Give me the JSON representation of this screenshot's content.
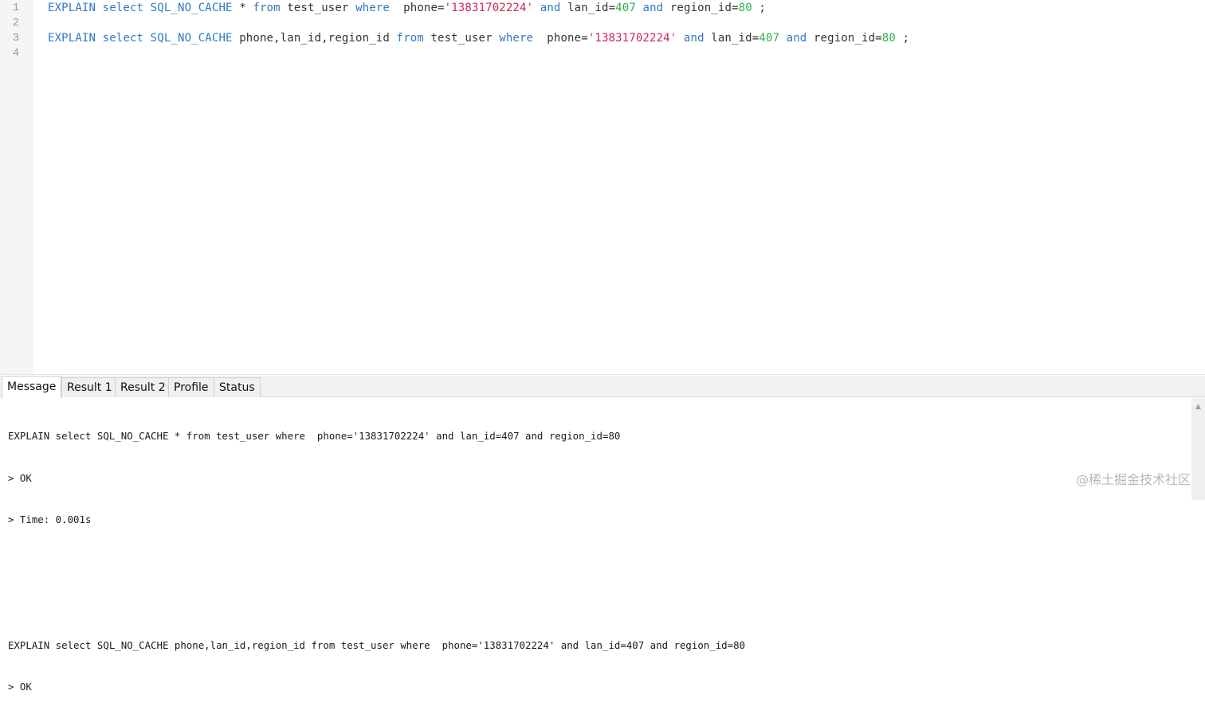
{
  "editor": {
    "line_numbers": [
      "1",
      "2",
      "3",
      "4"
    ],
    "line1": {
      "t1": "EXPLAIN select SQL_NO_CACHE",
      "t2": " * ",
      "t3": "from",
      "t4": " test_user ",
      "t5": "where",
      "t6": "  phone=",
      "t7": "'13831702224'",
      "t8": " ",
      "t9": "and",
      "t10": " lan_id=",
      "t11": "407",
      "t12": " ",
      "t13": "and",
      "t14": " region_id=",
      "t15": "80",
      "t16": " ;"
    },
    "line3": {
      "t1": "EXPLAIN select SQL_NO_CACHE",
      "t2": " phone,lan_id,region_id ",
      "t3": "from",
      "t4": " test_user ",
      "t5": "where",
      "t6": "  phone=",
      "t7": "'13831702224'",
      "t8": " ",
      "t9": "and",
      "t10": " lan_id=",
      "t11": "407",
      "t12": " ",
      "t13": "and",
      "t14": " region_id=",
      "t15": "80",
      "t16": " ;"
    }
  },
  "panel": {
    "tabs": [
      "Message",
      "Result 1",
      "Result 2",
      "Profile",
      "Status"
    ],
    "messages": [
      "EXPLAIN select SQL_NO_CACHE * from test_user where  phone='13831702224' and lan_id=407 and region_id=80",
      "> OK",
      "> Time: 0.001s",
      "",
      "",
      "EXPLAIN select SQL_NO_CACHE phone,lan_id,region_id from test_user where  phone='13831702224' and lan_id=407 and region_id=80",
      "> OK"
    ],
    "watermark": "@稀土掘金技术社区"
  },
  "colors": {
    "keyword": "#2f78c4",
    "string": "#d6224f",
    "number": "#2bb24c"
  }
}
